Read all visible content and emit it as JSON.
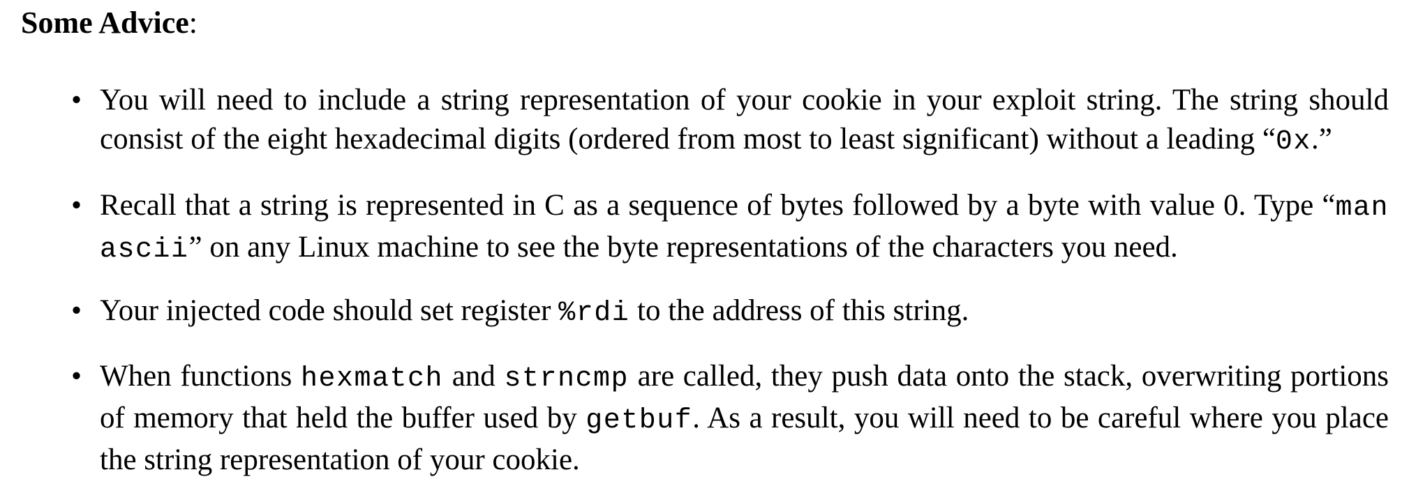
{
  "heading": {
    "title": "Some Advice",
    "colon": ":"
  },
  "advice": [
    {
      "bullet": "•",
      "p1": "You will need to include a string representation of your cookie in your exploit string. The string should consist of the eight hexadecimal digits (ordered from most to least significant) without a leading “",
      "code1": "0x",
      "p2": ".”"
    },
    {
      "bullet": "•",
      "p1": "Recall that a string is represented in C as a sequence of bytes followed by a byte with value 0. Type “",
      "code1": "man ascii",
      "p2": "” on any Linux machine to see the byte representations of the characters you need."
    },
    {
      "bullet": "•",
      "p1": "Your injected code should set register ",
      "code1": "%rdi",
      "p2": " to the address of this string."
    },
    {
      "bullet": "•",
      "p1": "When functions ",
      "code1": "hexmatch",
      "p2": " and ",
      "code2": "strncmp",
      "p3": " are called, they push data onto the stack, overwriting portions of memory that held the buffer used by ",
      "code3": "getbuf",
      "p4": ". As a result, you will need to be careful where you place the string representation of your cookie."
    }
  ]
}
